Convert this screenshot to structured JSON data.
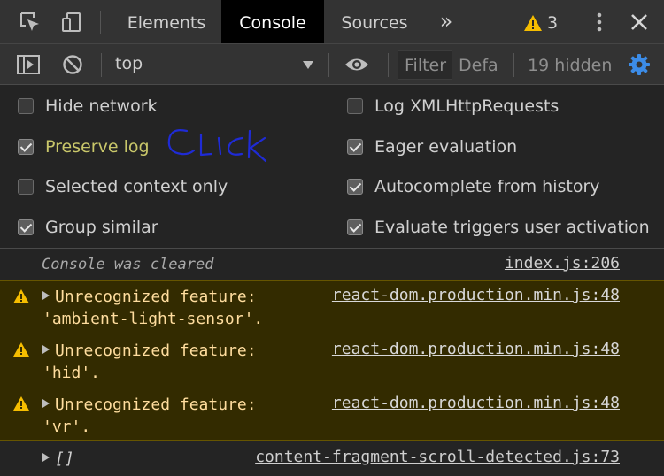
{
  "tabs": {
    "elements": "Elements",
    "console": "Console",
    "sources": "Sources",
    "more": "»",
    "warning_count": "3"
  },
  "toolbar": {
    "context": "top",
    "filter_placeholder": "Filter",
    "levels": "Defa",
    "hidden": "19 hidden"
  },
  "settings": {
    "hide_network": "Hide network",
    "preserve_log": "Preserve log",
    "selected_context": "Selected context only",
    "group_similar": "Group similar",
    "log_xhr": "Log XMLHttpRequests",
    "eager_eval": "Eager evaluation",
    "autocomplete": "Autocomplete from history",
    "evaluate_triggers": "Evaluate triggers user activation",
    "states": {
      "hide_network": false,
      "preserve_log": true,
      "selected_context": false,
      "group_similar": true,
      "log_xhr": false,
      "eager_eval": true,
      "autocomplete": true,
      "evaluate_triggers": true
    }
  },
  "annotation": "click",
  "messages": [
    {
      "text": "Console was cleared",
      "source": "index.js:206"
    },
    {
      "text_line1": "Unrecognized feature:",
      "text_line2": "'ambient-light-sensor'.",
      "source": "react-dom.production.min.js:48"
    },
    {
      "text_line1": "Unrecognized feature:",
      "text_line2": "'hid'.",
      "source": "react-dom.production.min.js:48"
    },
    {
      "text_line1": "Unrecognized feature:",
      "text_line2": "'vr'.",
      "source": "react-dom.production.min.js:48"
    },
    {
      "text": "[]",
      "source": "content-fragment-scroll-detected.js:73"
    }
  ],
  "colors": {
    "warning_bg": "#332b00",
    "warning_text": "#ffdd9e",
    "accent_blue": "#3c8ce7",
    "annotation_ink": "#1f2bd6",
    "preserve_log_highlight": "#c9c76a"
  }
}
